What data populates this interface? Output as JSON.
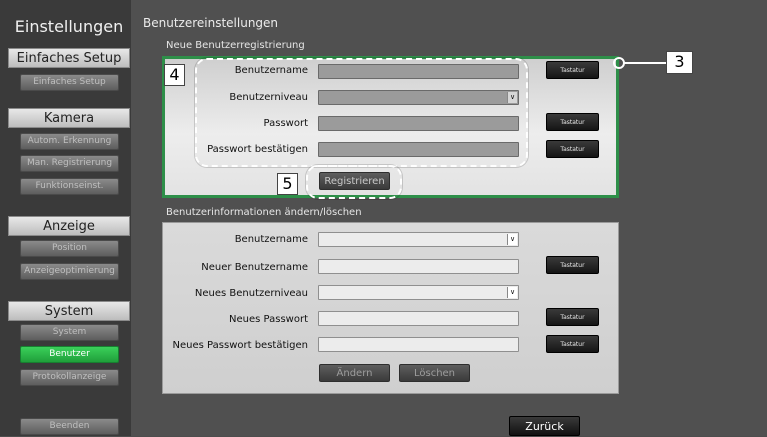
{
  "sidebar": {
    "title": "Einstellungen",
    "sections": [
      {
        "label": "Einfaches Setup",
        "items": [
          "Einfaches Setup"
        ]
      },
      {
        "label": "Kamera",
        "items": [
          "Autom. Erkennung",
          "Man. Registrierung",
          "Funktionseinst."
        ]
      },
      {
        "label": "Anzeige",
        "items": [
          "Position",
          "Anzeigeoptimierung"
        ]
      },
      {
        "label": "System",
        "items": [
          "System",
          "Benutzer",
          "Protokollanzeige"
        ]
      }
    ],
    "exit_label": "Beenden",
    "active_item": "Benutzer"
  },
  "page": {
    "title": "Benutzereinstellungen",
    "back_label": "Zurück"
  },
  "new_user": {
    "group_title": "Neue Benutzerregistrierung",
    "fields": {
      "username": {
        "label": "Benutzername",
        "value": ""
      },
      "level": {
        "label": "Benutzerniveau",
        "value": ""
      },
      "password": {
        "label": "Passwort",
        "value": ""
      },
      "password_confirm": {
        "label": "Passwort bestätigen",
        "value": ""
      }
    },
    "keyboard_label": "Tastatur",
    "register_label": "Registrieren"
  },
  "edit_user": {
    "group_title": "Benutzerinformationen ändern/löschen",
    "fields": {
      "username": {
        "label": "Benutzername",
        "value": ""
      },
      "new_username": {
        "label": "Neuer Benutzername",
        "value": ""
      },
      "new_level": {
        "label": "Neues Benutzerniveau",
        "value": ""
      },
      "new_password": {
        "label": "Neues Passwort",
        "value": ""
      },
      "new_password_confirm": {
        "label": "Neues Passwort bestätigen",
        "value": ""
      }
    },
    "keyboard_label": "Tastatur",
    "change_label": "Ändern",
    "delete_label": "Löschen"
  },
  "callouts": {
    "c3": "3",
    "c4": "4",
    "c5": "5"
  },
  "colors": {
    "accent_green": "#2e8f49",
    "active_button": "#28b848"
  }
}
